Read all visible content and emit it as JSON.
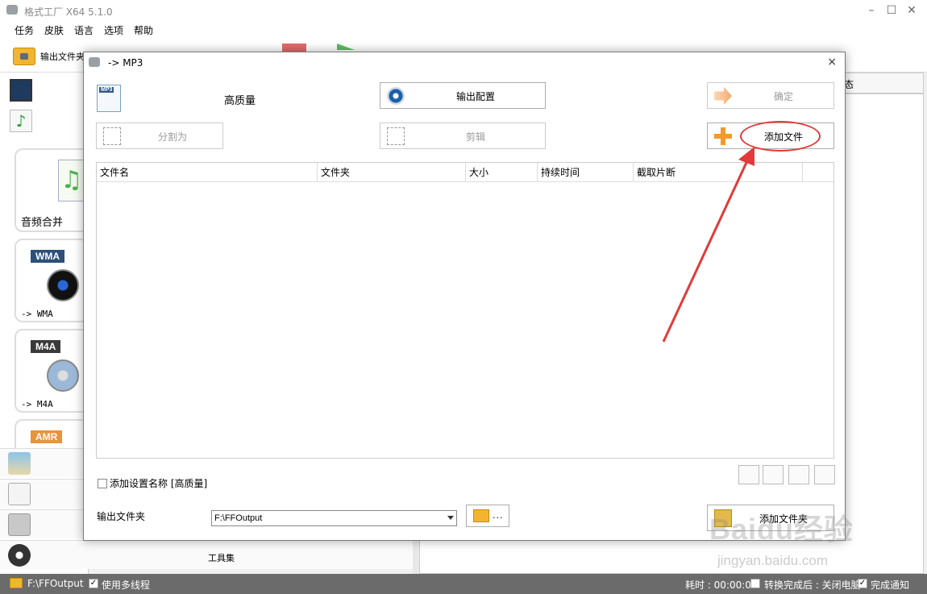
{
  "app": {
    "title": "格式工厂 X64 5.1.0"
  },
  "menu": [
    "任务",
    "皮肤",
    "语言",
    "选项",
    "帮助"
  ],
  "toolbar": {
    "output_folder_label": "输出文件夹"
  },
  "left": {
    "merge_label": "音频合并",
    "cards": [
      {
        "tag": "WMA",
        "label": "-> WMA",
        "tag_color": "#2d4f7a"
      },
      {
        "tag": "M4A",
        "label": "-> M4A",
        "tag_color": "#3a3a3a"
      },
      {
        "tag": "AMR",
        "label": "",
        "tag_color": "#e8943a"
      }
    ],
    "tools_label": "工具集"
  },
  "right": {
    "header_label": "态"
  },
  "statusbar": {
    "folder": "F:\\FFOutput",
    "multithread_label": "使用多线程",
    "elapsed": "耗时 : 00:00:00",
    "after_convert": "转换完成后 : 关闭电脑",
    "notify": "完成通知"
  },
  "dialog": {
    "title": "-> MP3",
    "quality": "高质量",
    "output_config_btn": "输出配置",
    "ok_btn": "确定",
    "split_btn": "分割为",
    "clip_btn": "剪辑",
    "add_file_btn": "添加文件",
    "columns": [
      "文件名",
      "文件夹",
      "大小",
      "持续时间",
      "截取片断"
    ],
    "add_setting_name": "添加设置名称 [高质量]",
    "output_folder_label": "输出文件夹",
    "output_folder_value": "F:\\FFOutput",
    "browse_dots": "...",
    "add_folder_btn": "添加文件夹",
    "close": "×",
    "highlight_color": "#e23a3a"
  },
  "watermark": {
    "brand": "Baidu经验",
    "url": "jingyan.baidu.com"
  }
}
